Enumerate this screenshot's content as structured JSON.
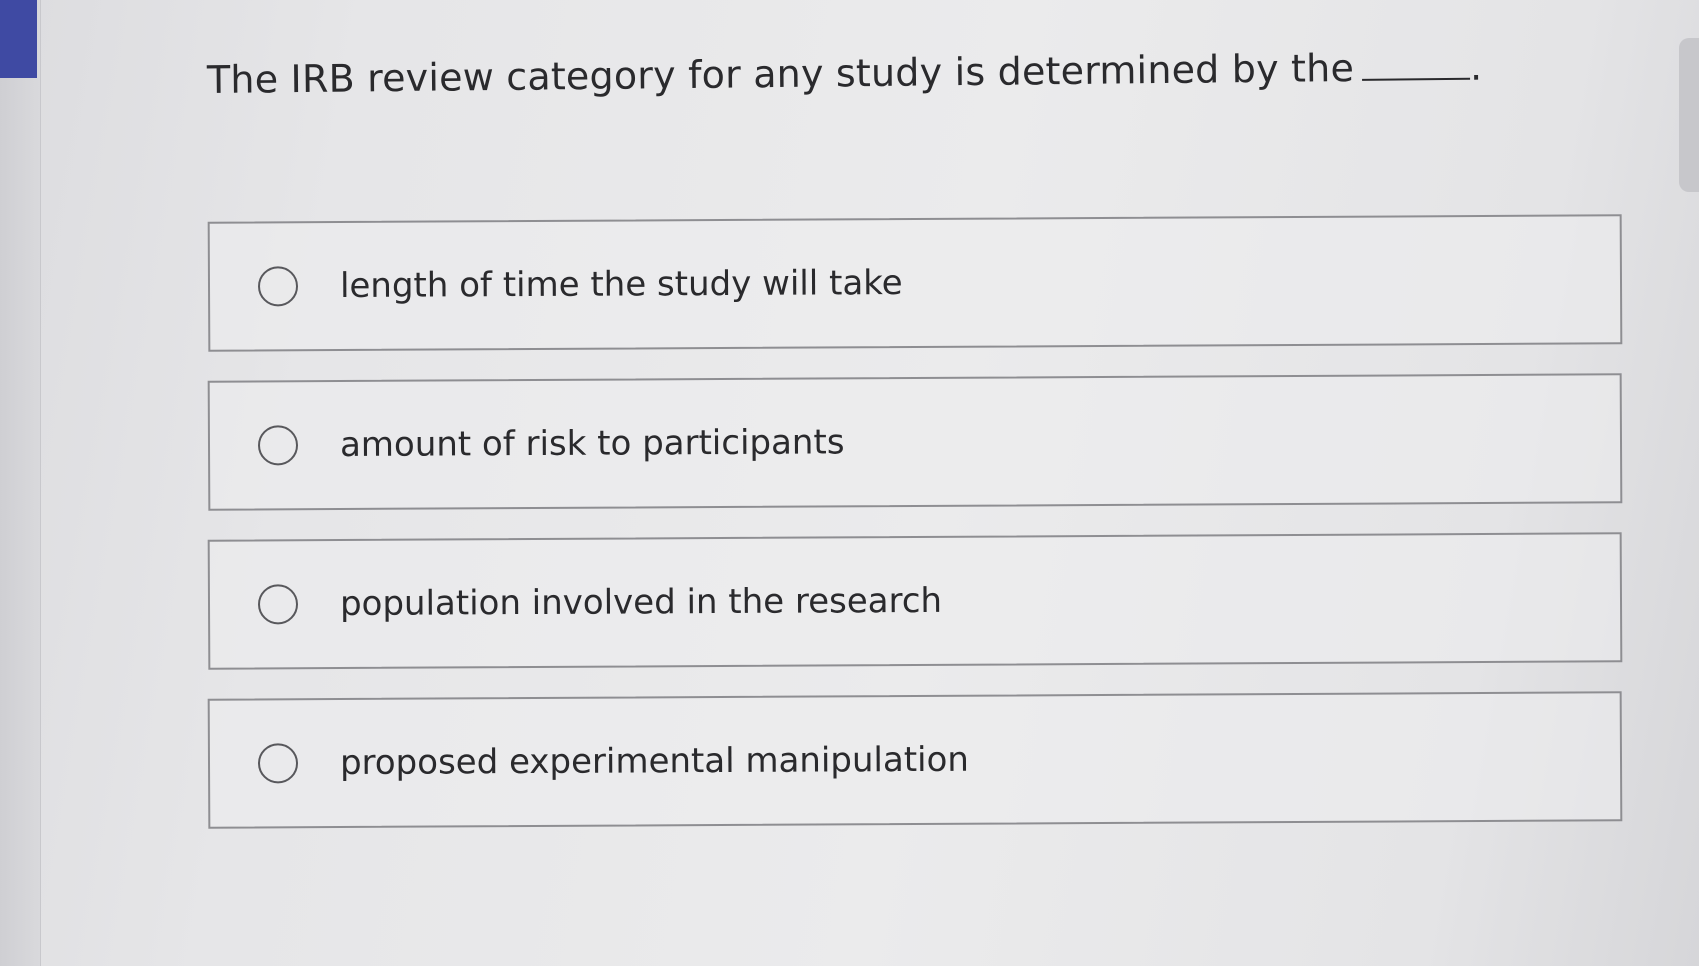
{
  "question": {
    "text": "The IRB review category for any study is determined by the",
    "blank_suffix": "."
  },
  "options": [
    {
      "label": "length of time the study will take",
      "selected": false
    },
    {
      "label": "amount of risk to participants",
      "selected": false
    },
    {
      "label": "population involved in the research",
      "selected": false
    },
    {
      "label": "proposed experimental manipulation",
      "selected": false
    }
  ],
  "colors": {
    "accent": "#3f4aa3",
    "border": "#8e8e92",
    "text": "#2a2a2d"
  }
}
